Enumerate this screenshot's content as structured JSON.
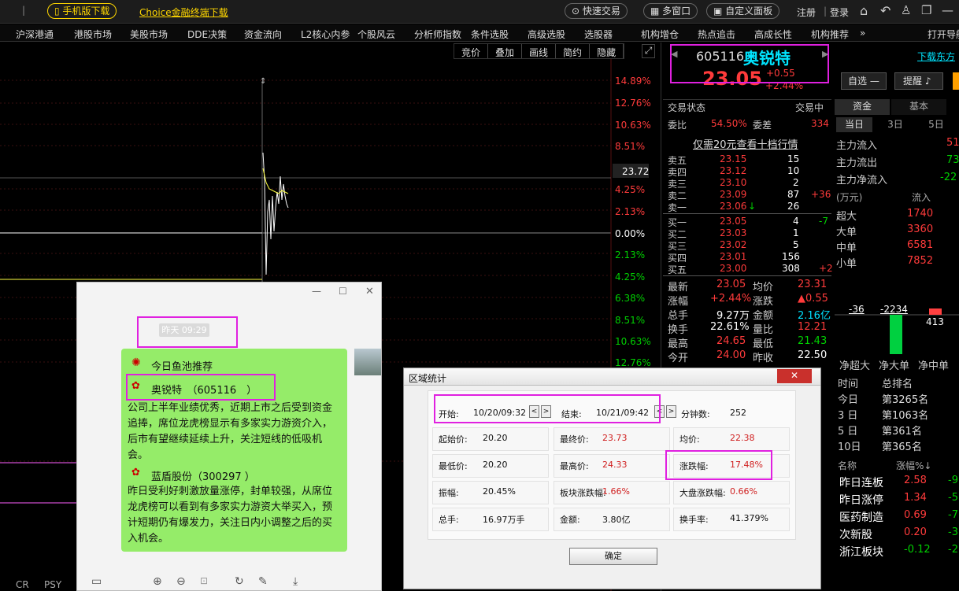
{
  "topbar": {
    "mobile_download": "手机版下载",
    "choice_download": "Choice金融终端下载",
    "quick_trade": "快速交易",
    "multi_window": "多窗口",
    "custom_panel": "自定义面板",
    "register": "注册",
    "login": "登录"
  },
  "menu": [
    "沪深港通",
    "港股市场",
    "美股市场",
    "DDE决策",
    "资金流向",
    "L2核心内参",
    "个股风云",
    "分析师指数",
    "条件选股",
    "高级选股",
    "选股器",
    "机构增仓",
    "热点追击",
    "高成长性",
    "机构推荐"
  ],
  "menu_more": "»",
  "menu_right": "打开导航",
  "chart_toolbar": [
    "竞价",
    "叠加",
    "画线",
    "简约",
    "隐藏"
  ],
  "chart": {
    "pct_labels": [
      "14.89%",
      "12.76%",
      "10.63%",
      "8.51%",
      "4.25%",
      "2.13%",
      "0.00%",
      "2.13%",
      "4.25%",
      "6.38%",
      "8.51%",
      "10.63%",
      "12.76%"
    ],
    "price_tag": "23.72",
    "bottom_labels": [
      "CR",
      "PSY"
    ]
  },
  "quote": {
    "code": "605116",
    "name": "奥锐特",
    "price": "23.05",
    "change": "+0.55",
    "change_pct": "+2.44%",
    "download": "下载东方",
    "fav": "自选",
    "alert": "提醒"
  },
  "trade": {
    "status_label": "交易状态",
    "status_value": "交易中",
    "wb_label": "委比",
    "wb_value": "54.50%",
    "wc_label": "委差",
    "wc_value": "334",
    "promo": "仅需20元查看十档行情"
  },
  "asks": [
    {
      "l": "卖五",
      "p": "23.15",
      "v": "15",
      "d": ""
    },
    {
      "l": "卖四",
      "p": "23.12",
      "v": "10",
      "d": ""
    },
    {
      "l": "卖三",
      "p": "23.10",
      "v": "2",
      "d": ""
    },
    {
      "l": "卖二",
      "p": "23.09",
      "v": "87",
      "d": "+36"
    },
    {
      "l": "卖一",
      "p": "23.06",
      "v": "26",
      "d": ""
    }
  ],
  "bids": [
    {
      "l": "买一",
      "p": "23.05",
      "v": "4",
      "d": "-7"
    },
    {
      "l": "买二",
      "p": "23.03",
      "v": "1",
      "d": ""
    },
    {
      "l": "买三",
      "p": "23.02",
      "v": "5",
      "d": ""
    },
    {
      "l": "买四",
      "p": "23.01",
      "v": "156",
      "d": ""
    },
    {
      "l": "买五",
      "p": "23.00",
      "v": "308",
      "d": "+2"
    }
  ],
  "stats": [
    {
      "l1": "最新",
      "v1": "23.05",
      "l2": "均价",
      "v2": "23.31"
    },
    {
      "l1": "涨幅",
      "v1": "+2.44%",
      "l2": "涨跌",
      "v2": "▲0.55"
    },
    {
      "l1": "总手",
      "v1": "9.27万",
      "l2": "金额",
      "v2": "2.16亿"
    },
    {
      "l1": "换手",
      "v1": "22.61%",
      "l2": "量比",
      "v2": "12.21"
    },
    {
      "l1": "最高",
      "v1": "24.65",
      "l2": "最低",
      "v2": "21.43"
    },
    {
      "l1": "今开",
      "v1": "24.00",
      "l2": "昨收",
      "v2": "22.50"
    }
  ],
  "fund": {
    "tabs": [
      "资金",
      "基本"
    ],
    "periods": [
      "当日",
      "3日",
      "5日"
    ],
    "main": [
      {
        "l": "主力流入",
        "v": "51"
      },
      {
        "l": "主力流出",
        "v": "73"
      },
      {
        "l": "主力净流入",
        "v": "-22"
      }
    ],
    "unit": "(万元)",
    "inflow_header": "流入",
    "orders": [
      {
        "l": "超大",
        "v": "1740"
      },
      {
        "l": "大单",
        "v": "3360"
      },
      {
        "l": "中单",
        "v": "6581"
      },
      {
        "l": "小单",
        "v": "7852"
      }
    ],
    "bar_values": [
      "-36",
      "-2234",
      "413"
    ],
    "bar_labels": [
      "净超大",
      "净大单",
      "净中单"
    ],
    "rank_headers": [
      "时间",
      "总排名"
    ],
    "ranks": [
      {
        "t": "今日",
        "r": "第3265名"
      },
      {
        "t": "3 日",
        "r": "第1063名"
      },
      {
        "t": "5 日",
        "r": "第361名"
      },
      {
        "t": "10日",
        "r": "第365名"
      }
    ],
    "sector_headers": [
      "名称",
      "涨幅%↓"
    ],
    "sectors": [
      {
        "n": "昨日连板",
        "v": "2.58",
        "x": "-9"
      },
      {
        "n": "昨日涨停",
        "v": "1.34",
        "x": "-5"
      },
      {
        "n": "医药制造",
        "v": "0.69",
        "x": "-7"
      },
      {
        "n": "次新股",
        "v": "0.20",
        "x": "-3"
      },
      {
        "n": "浙江板块",
        "v": "-0.12",
        "x": "-2"
      }
    ]
  },
  "chat": {
    "time": "昨天 09:29",
    "title": "今日鱼池推荐",
    "stock1": "奥锐特　（605116　）",
    "text1": "公司上半年业绩优秀，近期上市之后受到资金追捧，席位龙虎榜显示有多家实力游资介入，后市有望继续延续上升，关注短线的低吸机会。",
    "stock2": "蓝盾股份（300297 ）",
    "text2": "昨日受利好刺激放量涨停，封单较强，从席位龙虎榜可以看到有多家实力游资大举买入，预计短期仍有爆发力，关注日内小调整之后的买入机会。"
  },
  "dialog": {
    "title": "区域统计",
    "close": "✕",
    "start_label": "开始:",
    "start": "10/20/09:32",
    "end_label": "结束:",
    "end": "10/21/09:42",
    "minutes_label": "分钟数:",
    "minutes": "252",
    "r1": [
      {
        "l": "起始价:",
        "v": "20.20"
      },
      {
        "l": "最终价:",
        "v": "23.73"
      },
      {
        "l": "均价:",
        "v": "22.38"
      }
    ],
    "r2": [
      {
        "l": "最低价:",
        "v": "20.20"
      },
      {
        "l": "最高价:",
        "v": "24.33"
      },
      {
        "l": "涨跌幅:",
        "v": "17.48%"
      }
    ],
    "r3": [
      {
        "l": "振幅:",
        "v": "20.45%"
      },
      {
        "l": "板块涨跌幅:",
        "v": "1.66%"
      },
      {
        "l": "大盘涨跌幅:",
        "v": "0.66%"
      }
    ],
    "r4": [
      {
        "l": "总手:",
        "v": "16.97万手"
      },
      {
        "l": "金额:",
        "v": "3.80亿"
      },
      {
        "l": "换手率:",
        "v": "41.379%"
      }
    ],
    "ok": "确定"
  }
}
